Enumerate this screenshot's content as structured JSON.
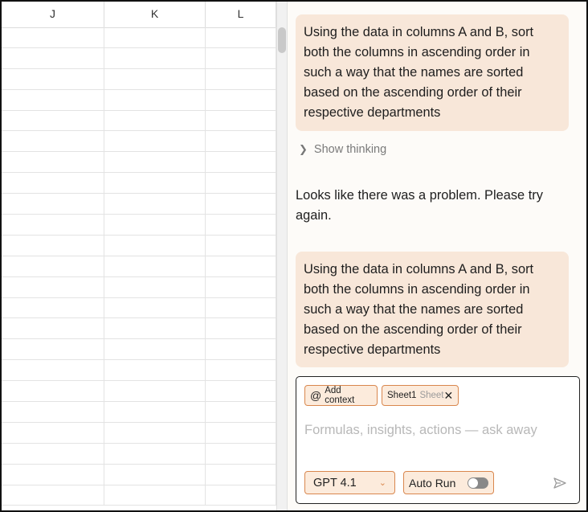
{
  "sheet": {
    "columns": [
      "J",
      "K",
      "L"
    ],
    "row_count": 23
  },
  "chat": {
    "messages": [
      {
        "role": "user",
        "text": "Using the data in columns A and B, sort both the columns in ascending order in such a way that the names are sorted based on the ascending order of their respective departments"
      },
      {
        "role": "thinking",
        "text": "Show thinking"
      },
      {
        "role": "assistant",
        "text": "Looks like there was a problem. Please try again."
      },
      {
        "role": "user",
        "text": "Using the data in columns A and B, sort both the columns in ascending order in such a way that the names are sorted based on the ascending order of their respective departments"
      }
    ]
  },
  "composer": {
    "add_context_label": "Add context",
    "context_chip": {
      "name": "Sheet1",
      "type": "Sheet"
    },
    "placeholder": "Formulas, insights, actions — ask away",
    "model_label": "GPT 4.1",
    "auto_run_label": "Auto Run",
    "auto_run_enabled": false
  },
  "colors": {
    "user_bubble": "#f8e7d9",
    "chip_border": "#d9874e",
    "chip_bg": "#fcebdc"
  }
}
